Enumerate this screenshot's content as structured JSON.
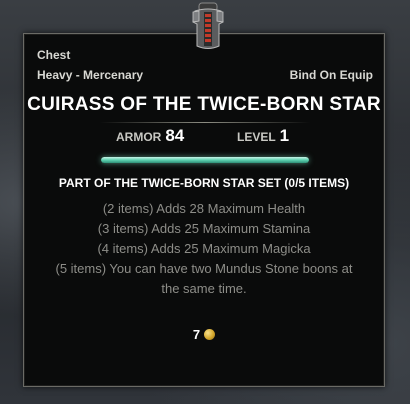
{
  "item": {
    "slot": "Chest",
    "type": "Heavy - Mercenary",
    "bind": "Bind On Equip",
    "name": "CUIRASS OF THE TWICE-BORN STAR",
    "icon": "cuirass-icon"
  },
  "stats": {
    "armor_label": "ARMOR",
    "armor_value": "84",
    "level_label": "LEVEL",
    "level_value": "1"
  },
  "condition_bar": {
    "fill_fraction": 1.0,
    "color": "#5ed2b1"
  },
  "set": {
    "header": "PART OF THE TWICE-BORN STAR SET (0/5 ITEMS)",
    "bonuses": [
      "(2 items) Adds 28 Maximum Health",
      "(3 items) Adds 25 Maximum Stamina",
      "(4 items) Adds 25 Maximum Magicka",
      "(5 items) You can have two Mundus Stone boons at the same time."
    ]
  },
  "value": {
    "amount": "7",
    "icon": "gold-coin-icon"
  }
}
